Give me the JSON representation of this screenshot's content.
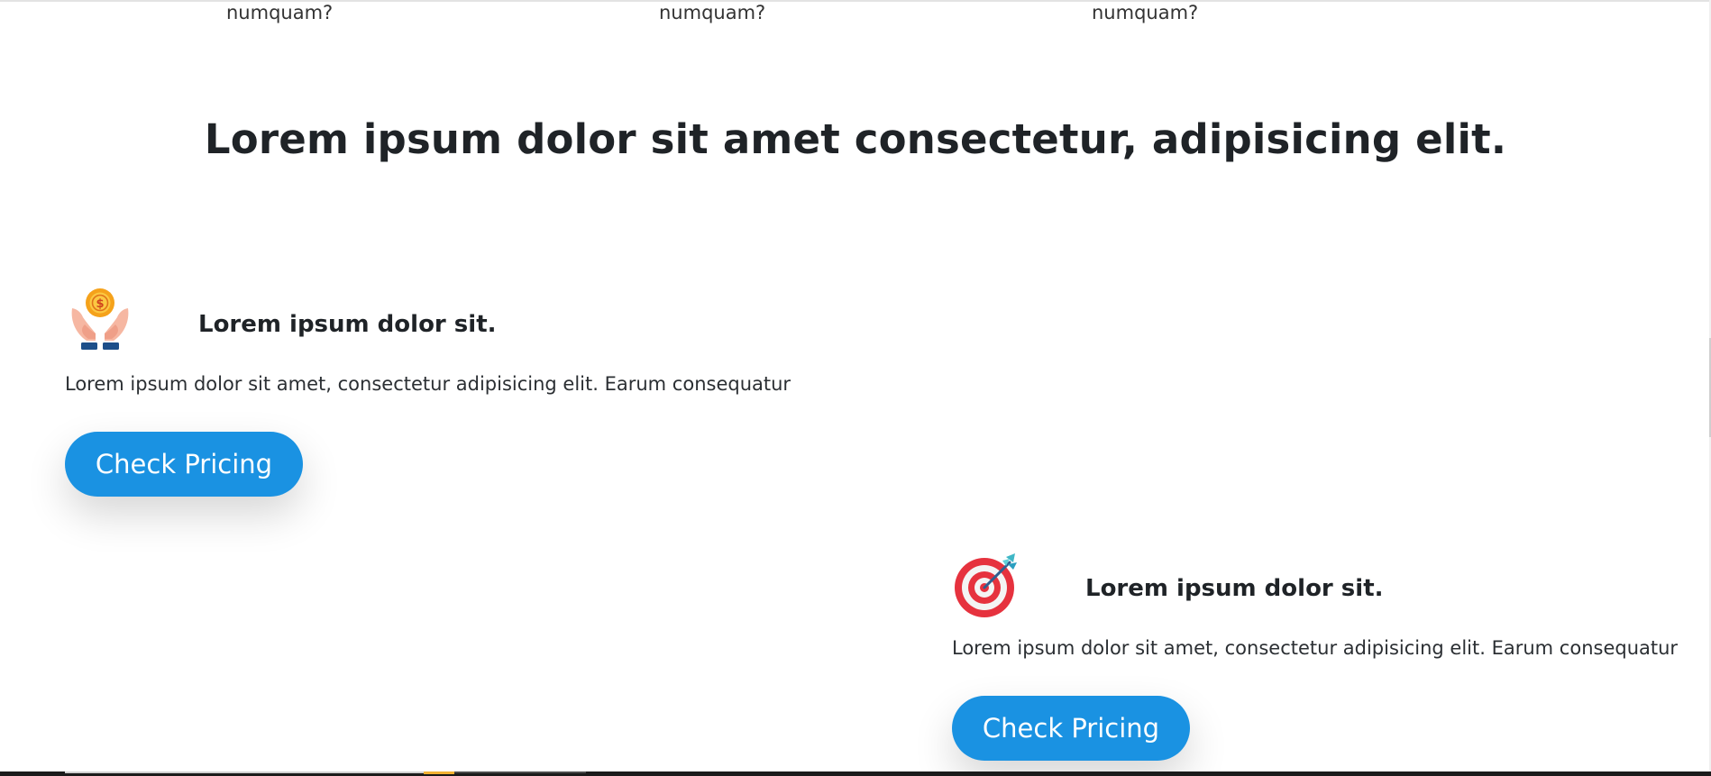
{
  "top_row": {
    "items": [
      "numquam?",
      "numquam?",
      "numquam?"
    ]
  },
  "section": {
    "heading": "Lorem ipsum dolor sit amet consectetur, adipisicing elit."
  },
  "cards": [
    {
      "icon": "hands-coin-icon",
      "title": "Lorem ipsum dolor sit.",
      "text": "Lorem ipsum dolor sit amet, consectetur adipisicing elit. Earum consequatur",
      "button_label": "Check Pricing"
    },
    {
      "icon": "target-dart-icon",
      "title": "Lorem ipsum dolor sit.",
      "text": "Lorem ipsum dolor sit amet, consectetur adipisicing elit. Earum consequatur",
      "button_label": "Check Pricing"
    }
  ],
  "colors": {
    "button": "#1a92e2",
    "heading": "#1f2327",
    "text": "#2b2f33"
  }
}
